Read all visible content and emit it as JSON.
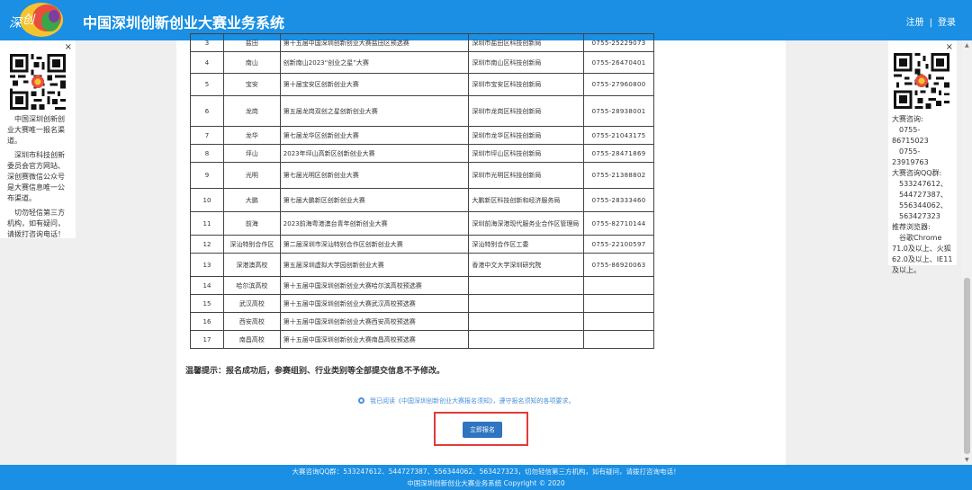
{
  "header": {
    "title": "中国深圳创新创业大赛业务系统",
    "register": "注册",
    "separator": "|",
    "login": "登录"
  },
  "left_panel": {
    "close": "×",
    "paragraphs": [
      "中国深圳创新创业大赛唯一报名渠道。",
      "深圳市科技创新委员会官方网站、深创赛微信公众号是大赛信息唯一公布渠道。",
      "切勿轻信第三方机构，如有疑问，请拨打咨询电话！"
    ]
  },
  "right_panel": {
    "close": "×",
    "consult_label": "大赛咨询:",
    "phones": [
      "0755-86715023",
      "0755-23919763"
    ],
    "qq_label": "大赛咨询QQ群:",
    "qq_groups": [
      "533247612、",
      "544727387、",
      "556344062、",
      "563427323"
    ],
    "browser_label": "推荐浏览器:",
    "browser_text": "谷歌Chrome 71.0及以上、火狐 62.0及以上、IE11及以上。"
  },
  "table": {
    "rows": [
      {
        "no": "3",
        "area": "盐田",
        "event": "第十五届中国深圳创新创业大赛盐田区预选赛",
        "org": "深圳市盐田区科技创新局",
        "tel": "0755-25229073"
      },
      {
        "no": "4",
        "area": "南山",
        "event": "创新南山2023“创业之星”大赛",
        "org": "深圳市南山区科技创新局",
        "tel": "0755-26470401"
      },
      {
        "no": "5",
        "area": "宝安",
        "event": "第十届宝安区创新创业大赛",
        "org": "深圳市宝安区科技创新局",
        "tel": "0755-27960800"
      },
      {
        "no": "6",
        "area": "龙岗",
        "event": "第五届龙岗双创之星创新创业大赛",
        "org": "深圳市龙岗区科技创新局",
        "tel": "0755-28938001"
      },
      {
        "no": "7",
        "area": "龙华",
        "event": "第七届龙华区创新创业大赛",
        "org": "深圳市龙华区科技创新局",
        "tel": "0755-21043175"
      },
      {
        "no": "8",
        "area": "坪山",
        "event": "2023年坪山高新区创新创业大赛",
        "org": "深圳市坪山区科技创新局",
        "tel": "0755-28471869"
      },
      {
        "no": "9",
        "area": "光明",
        "event": "第七届光明区创新创业大赛",
        "org": "深圳市光明区科技创新局",
        "tel": "0755-21388802"
      },
      {
        "no": "10",
        "area": "大鹏",
        "event": "第七届大鹏新区创新创业大赛",
        "org": "大鹏新区科技创新和经济服务局",
        "tel": "0755-28333460"
      },
      {
        "no": "11",
        "area": "前海",
        "event": "2023前海粤港澳台青年创新创业大赛",
        "org": "深圳前海深港现代服务业合作区管理局",
        "tel": "0755-82710144"
      },
      {
        "no": "12",
        "area": "深汕特别合作区",
        "event": "第二届深圳市深汕特别合作区创新创业大赛",
        "org": "深汕特别合作区工委",
        "tel": "0755-22100597"
      },
      {
        "no": "13",
        "area": "深港澳高校",
        "event": "第五届深圳虚拟大学园创新创业大赛",
        "org": "香港中文大学深圳研究院",
        "tel": "0755-86920063"
      },
      {
        "no": "14",
        "area": "哈尔滨高校",
        "event": "第十五届中国深圳创新创业大赛哈尔滨高校预选赛",
        "org": "",
        "tel": ""
      },
      {
        "no": "15",
        "area": "武汉高校",
        "event": "第十五届中国深圳创新创业大赛武汉高校预选赛",
        "org": "",
        "tel": ""
      },
      {
        "no": "16",
        "area": "西安高校",
        "event": "第十五届中国深圳创新创业大赛西安高校预选赛",
        "org": "",
        "tel": ""
      },
      {
        "no": "17",
        "area": "南昌高校",
        "event": "第十五届中国深圳创新创业大赛南昌高校预选赛",
        "org": "",
        "tel": ""
      }
    ]
  },
  "notice": "温馨提示：报名成功后，参赛组别、行业类别等全部提交信息不予修改。",
  "agreement": "我已阅读《中国深圳创新创业大赛报名须知》，遵守报名须知的各项要求。",
  "apply_button": "立即报名",
  "footer": {
    "line1": "大赛咨询QQ群：533247612、544727387、556344062、563427323，切勿轻信第三方机构，如有疑问，请拨打咨询电话！",
    "line2": "中国深圳创新创业大赛业务系统 Copyright © 2020"
  },
  "colors": {
    "brand_blue": "#1a8fe3",
    "button_blue": "#2f74c0",
    "highlight_red": "#e23b3b"
  }
}
